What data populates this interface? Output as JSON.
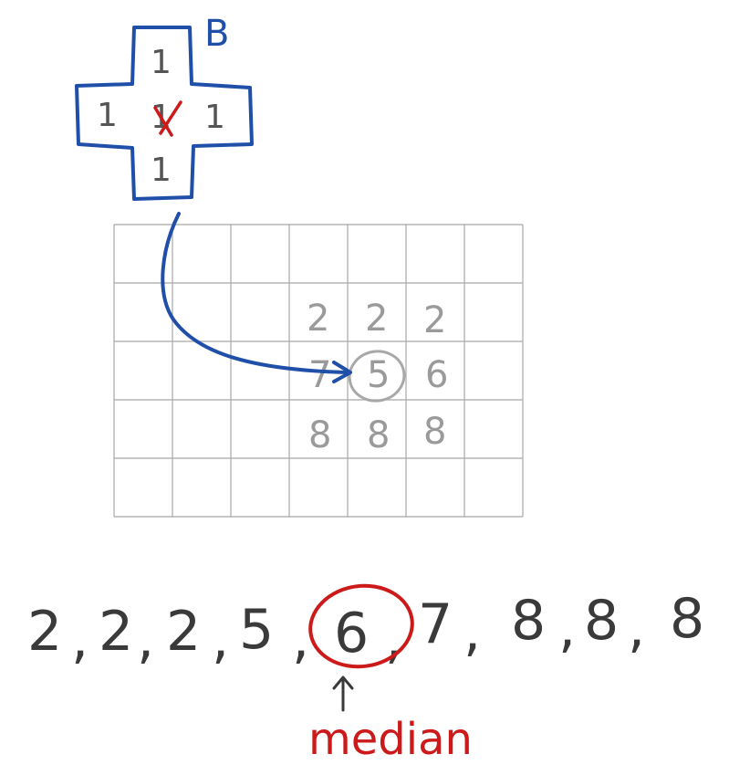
{
  "structuring_element": {
    "label": "B",
    "cells": {
      "top": "1",
      "left": "1",
      "center": "1",
      "right": "1",
      "bottom": "1"
    },
    "color": "#1f4fa8",
    "cross_color": "#cc1a1a"
  },
  "grid": {
    "cols": 7,
    "rows": 5,
    "line_color": "#a8a8a8",
    "values": [
      [
        "2",
        "2",
        "2"
      ],
      [
        "7",
        "5",
        "6"
      ],
      [
        "8",
        "8",
        "8"
      ]
    ],
    "value_color": "#9a9a9a"
  },
  "sorted_sequence": {
    "values": [
      "2",
      "2",
      "2",
      "5",
      "6",
      "7",
      "8",
      "8",
      "8"
    ],
    "median_index": 4,
    "text_color": "#3a3a3a"
  },
  "median_label": {
    "text": "median",
    "color": "#cc1a1a"
  }
}
